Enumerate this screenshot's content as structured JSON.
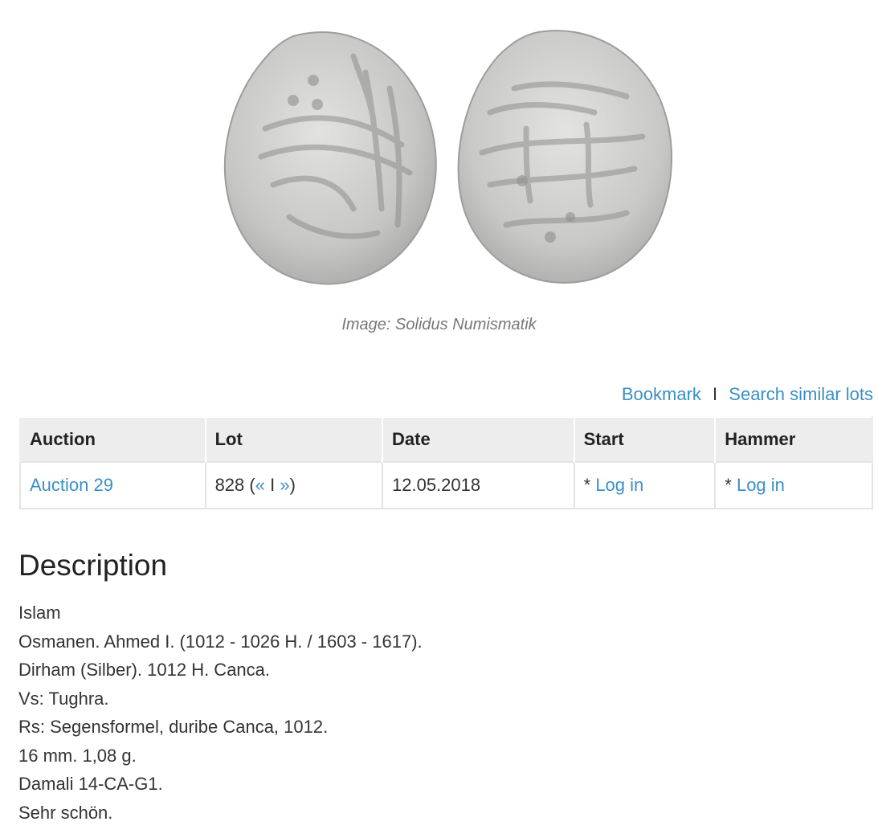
{
  "image": {
    "caption": "Image: Solidus Numismatik"
  },
  "actions": {
    "bookmark": "Bookmark",
    "separator": "I",
    "search_similar": "Search similar lots"
  },
  "table": {
    "headers": {
      "auction": "Auction",
      "lot": "Lot",
      "date": "Date",
      "start": "Start",
      "hammer": "Hammer"
    },
    "row": {
      "auction": "Auction 29",
      "lot_number": "828 (",
      "prev": "«",
      "lot_sep": " I ",
      "next": "»",
      "lot_close": ")",
      "date": "12.05.2018",
      "start_prefix": "* ",
      "start_link": "Log in",
      "hammer_prefix": "* ",
      "hammer_link": "Log in"
    }
  },
  "description": {
    "title": "Description",
    "lines": [
      "Islam",
      "Osmanen. Ahmed I. (1012 - 1026 H. / 1603 - 1617).",
      "Dirham (Silber). 1012 H. Canca.",
      "Vs: Tughra.",
      "Rs: Segensformel, duribe Canca, 1012.",
      "16 mm. 1,08 g.",
      "Damali 14-CA-G1.",
      "Sehr schön."
    ]
  },
  "colors": {
    "link": "#3a8fc4",
    "header_bg": "#ededed",
    "coin_silver": "#c9c9c7"
  }
}
